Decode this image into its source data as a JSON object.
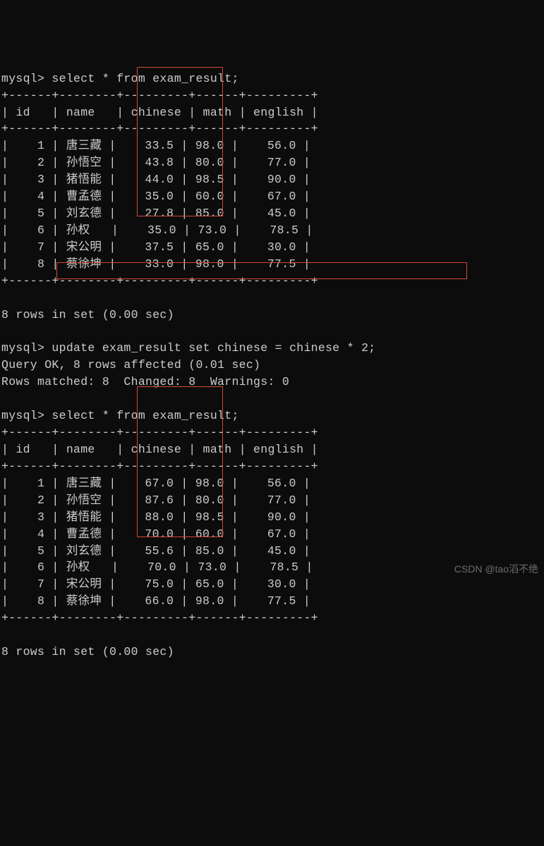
{
  "prompt": "mysql>",
  "query1": "select * from exam_result;",
  "query2": "update exam_result set chinese = chinese * 2;",
  "query3": "select * from exam_result;",
  "header_border": "+------+--------+---------+------+---------+",
  "row_border": "+------+--------+---------+------+---------+",
  "columns": [
    "id",
    "name",
    "chinese",
    "math",
    "english"
  ],
  "table1": [
    {
      "id": "1",
      "name": "唐三藏",
      "chinese": "33.5",
      "math": "98.0",
      "english": "56.0"
    },
    {
      "id": "2",
      "name": "孙悟空",
      "chinese": "43.8",
      "math": "80.0",
      "english": "77.0"
    },
    {
      "id": "3",
      "name": "猪悟能",
      "chinese": "44.0",
      "math": "98.5",
      "english": "90.0"
    },
    {
      "id": "4",
      "name": "曹孟德",
      "chinese": "35.0",
      "math": "60.0",
      "english": "67.0"
    },
    {
      "id": "5",
      "name": "刘玄德",
      "chinese": "27.8",
      "math": "85.0",
      "english": "45.0"
    },
    {
      "id": "6",
      "name": "孙权",
      "chinese": "35.0",
      "math": "73.0",
      "english": "78.5"
    },
    {
      "id": "7",
      "name": "宋公明",
      "chinese": "37.5",
      "math": "65.0",
      "english": "30.0"
    },
    {
      "id": "8",
      "name": "蔡徐坤",
      "chinese": "33.0",
      "math": "98.0",
      "english": "77.5"
    }
  ],
  "rows_in_set": "8 rows in set (0.00 sec)",
  "update_result_line1": "Query OK, 8 rows affected (0.01 sec)",
  "update_result_line2": "Rows matched: 8  Changed: 8  Warnings: 0",
  "table2": [
    {
      "id": "1",
      "name": "唐三藏",
      "chinese": "67.0",
      "math": "98.0",
      "english": "56.0"
    },
    {
      "id": "2",
      "name": "孙悟空",
      "chinese": "87.6",
      "math": "80.0",
      "english": "77.0"
    },
    {
      "id": "3",
      "name": "猪悟能",
      "chinese": "88.0",
      "math": "98.5",
      "english": "90.0"
    },
    {
      "id": "4",
      "name": "曹孟德",
      "chinese": "70.0",
      "math": "60.0",
      "english": "67.0"
    },
    {
      "id": "5",
      "name": "刘玄德",
      "chinese": "55.6",
      "math": "85.0",
      "english": "45.0"
    },
    {
      "id": "6",
      "name": "孙权",
      "chinese": "70.0",
      "math": "73.0",
      "english": "78.5"
    },
    {
      "id": "7",
      "name": "宋公明",
      "chinese": "75.0",
      "math": "65.0",
      "english": "30.0"
    },
    {
      "id": "8",
      "name": "蔡徐坤",
      "chinese": "66.0",
      "math": "98.0",
      "english": "77.5"
    }
  ],
  "watermark": "CSDN @tao滔不绝"
}
